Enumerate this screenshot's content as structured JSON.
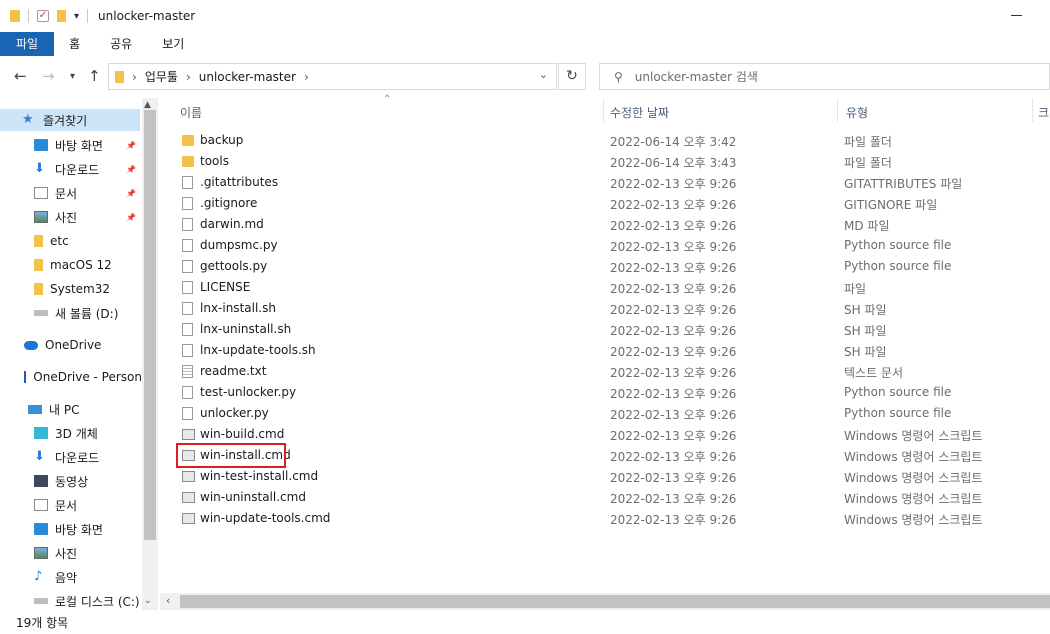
{
  "window": {
    "title": "unlocker-master"
  },
  "ribbon": {
    "tabs": [
      "파일",
      "홈",
      "공유",
      "보기"
    ]
  },
  "address": {
    "segments": [
      "업무툴",
      "unlocker-master"
    ],
    "search_placeholder": "unlocker-master 검색"
  },
  "sidebar": {
    "items": [
      {
        "label": "즐겨찾기",
        "icon": "star-icon",
        "selected": true
      },
      {
        "label": "바탕 화면",
        "icon": "desktop-icon",
        "pinned": true
      },
      {
        "label": "다운로드",
        "icon": "download-arrow-icon",
        "pinned": true
      },
      {
        "label": "문서",
        "icon": "document-icon",
        "pinned": true
      },
      {
        "label": "사진",
        "icon": "pictures-icon",
        "pinned": true
      },
      {
        "label": "etc",
        "icon": "folder-icon"
      },
      {
        "label": "macOS 12",
        "icon": "folder-icon"
      },
      {
        "label": "System32",
        "icon": "folder-icon"
      },
      {
        "label": "새 볼륨 (D:)",
        "icon": "drive-icon"
      },
      {
        "label": "OneDrive",
        "icon": "cloud-icon"
      },
      {
        "label": "OneDrive - Person",
        "icon": "onedrive-business-icon"
      },
      {
        "label": "내 PC",
        "icon": "pc-icon"
      },
      {
        "label": "3D 개체",
        "icon": "cube-3d-icon"
      },
      {
        "label": "다운로드",
        "icon": "download-arrow-icon"
      },
      {
        "label": "동영상",
        "icon": "video-icon"
      },
      {
        "label": "문서",
        "icon": "document-icon"
      },
      {
        "label": "바탕 화면",
        "icon": "desktop-icon"
      },
      {
        "label": "사진",
        "icon": "pictures-icon"
      },
      {
        "label": "음악",
        "icon": "music-icon"
      },
      {
        "label": "로컬 디스크 (C:)",
        "icon": "drive-icon"
      }
    ]
  },
  "columns": {
    "name": "이름",
    "date": "수정한 날짜",
    "type": "유형",
    "size": "크"
  },
  "files": [
    {
      "name": "backup",
      "date": "2022-06-14 오후 3:42",
      "type": "파일 폴더",
      "icon": "folder"
    },
    {
      "name": "tools",
      "date": "2022-06-14 오후 3:43",
      "type": "파일 폴더",
      "icon": "folder"
    },
    {
      "name": ".gitattributes",
      "date": "2022-02-13 오후 9:26",
      "type": "GITATTRIBUTES 파일",
      "icon": "file"
    },
    {
      "name": ".gitignore",
      "date": "2022-02-13 오후 9:26",
      "type": "GITIGNORE 파일",
      "icon": "file"
    },
    {
      "name": "darwin.md",
      "date": "2022-02-13 오후 9:26",
      "type": "MD 파일",
      "icon": "file"
    },
    {
      "name": "dumpsmc.py",
      "date": "2022-02-13 오후 9:26",
      "type": "Python source file",
      "icon": "file"
    },
    {
      "name": "gettools.py",
      "date": "2022-02-13 오후 9:26",
      "type": "Python source file",
      "icon": "file"
    },
    {
      "name": "LICENSE",
      "date": "2022-02-13 오후 9:26",
      "type": "파일",
      "icon": "file"
    },
    {
      "name": "lnx-install.sh",
      "date": "2022-02-13 오후 9:26",
      "type": "SH 파일",
      "icon": "file"
    },
    {
      "name": "lnx-uninstall.sh",
      "date": "2022-02-13 오후 9:26",
      "type": "SH 파일",
      "icon": "file"
    },
    {
      "name": "lnx-update-tools.sh",
      "date": "2022-02-13 오후 9:26",
      "type": "SH 파일",
      "icon": "file"
    },
    {
      "name": "readme.txt",
      "date": "2022-02-13 오후 9:26",
      "type": "텍스트 문서",
      "icon": "txt"
    },
    {
      "name": "test-unlocker.py",
      "date": "2022-02-13 오후 9:26",
      "type": "Python source file",
      "icon": "file"
    },
    {
      "name": "unlocker.py",
      "date": "2022-02-13 오후 9:26",
      "type": "Python source file",
      "icon": "file"
    },
    {
      "name": "win-build.cmd",
      "date": "2022-02-13 오후 9:26",
      "type": "Windows 명령어 스크립트",
      "icon": "cmd"
    },
    {
      "name": "win-install.cmd",
      "date": "2022-02-13 오후 9:26",
      "type": "Windows 명령어 스크립트",
      "icon": "cmd",
      "highlighted": true
    },
    {
      "name": "win-test-install.cmd",
      "date": "2022-02-13 오후 9:26",
      "type": "Windows 명령어 스크립트",
      "icon": "cmd"
    },
    {
      "name": "win-uninstall.cmd",
      "date": "2022-02-13 오후 9:26",
      "type": "Windows 명령어 스크립트",
      "icon": "cmd"
    },
    {
      "name": "win-update-tools.cmd",
      "date": "2022-02-13 오후 9:26",
      "type": "Windows 명령어 스크립트",
      "icon": "cmd"
    }
  ],
  "status": {
    "count": "19개 항목"
  },
  "colors": {
    "accent": "#1a64b4",
    "selection": "#cce4f7",
    "highlight_border": "#d81e1e",
    "folder": "#f2c24b"
  }
}
